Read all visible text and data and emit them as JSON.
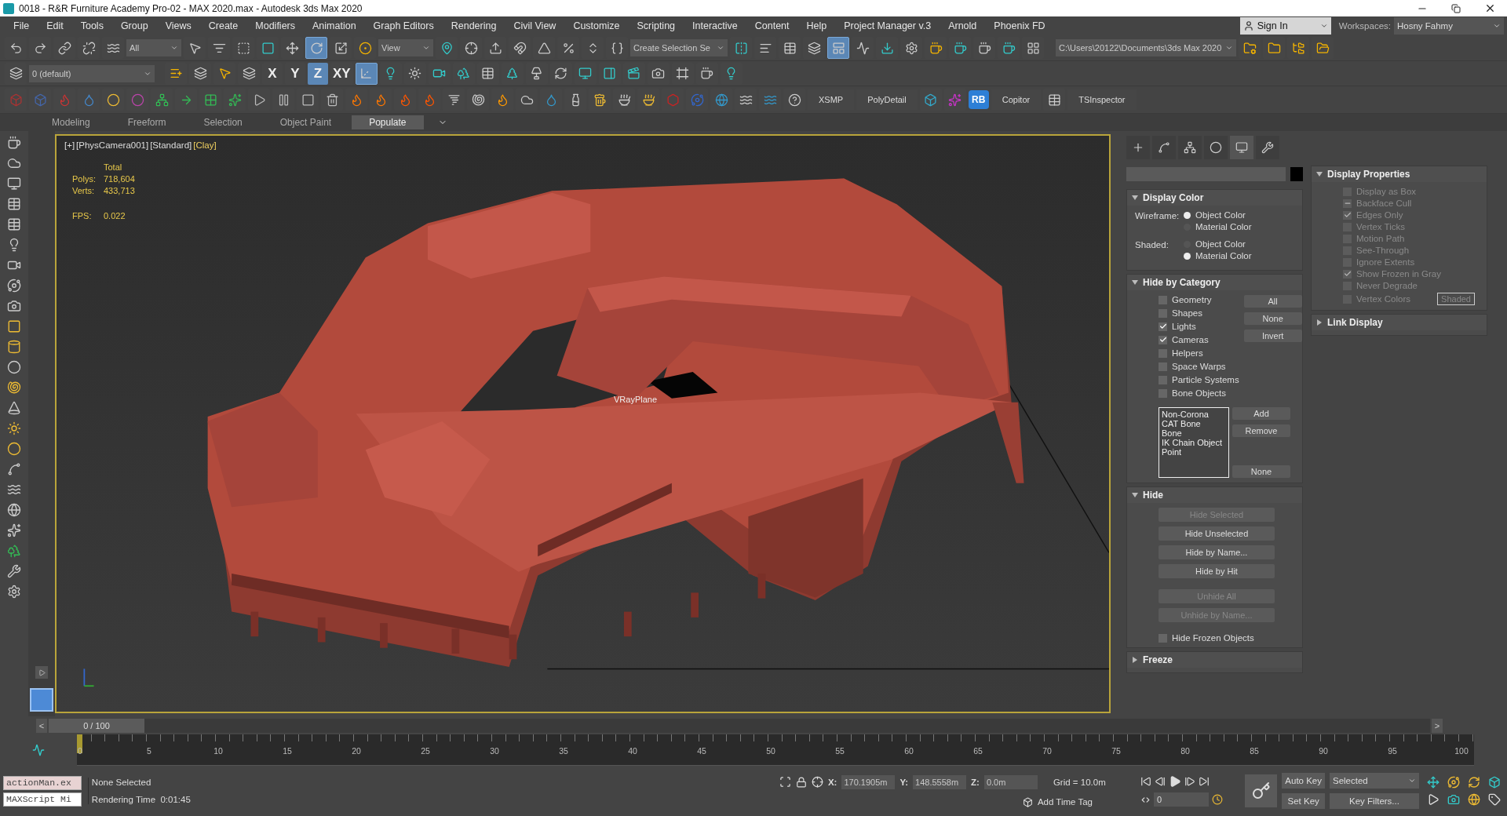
{
  "window": {
    "title": "0018 - R&R Furniture Academy Pro-02 - MAX 2020.max - Autodesk 3ds Max 2020"
  },
  "menu": [
    "File",
    "Edit",
    "Tools",
    "Group",
    "Views",
    "Create",
    "Modifiers",
    "Animation",
    "Graph Editors",
    "Rendering",
    "Civil View",
    "Customize",
    "Scripting",
    "Interactive",
    "Content",
    "Help",
    "Project Manager v.3",
    "Arnold",
    "Phoenix FD"
  ],
  "account": {
    "sign_in": "Sign In",
    "workspaces_label": "Workspaces:",
    "workspace": "Hosny Fahmy"
  },
  "toolbar_main": [
    {
      "kind": "button",
      "selected": false
    },
    {
      "kind": "button",
      "selected": false
    },
    {
      "kind": "button",
      "selected": false
    },
    {
      "kind": "button",
      "selected": false
    },
    {
      "kind": "button",
      "selected": false
    },
    {
      "kind": "dropdown",
      "value": "All"
    },
    {
      "kind": "button",
      "selected": false
    },
    {
      "kind": "button",
      "selected": false
    },
    {
      "kind": "button",
      "selected": false
    },
    {
      "kind": "button",
      "selected": false
    },
    {
      "kind": "button",
      "selected": false
    },
    {
      "kind": "button",
      "selected": true
    },
    {
      "kind": "button",
      "selected": false
    },
    {
      "kind": "button",
      "selected": false
    },
    {
      "kind": "dropdown",
      "value": "View"
    },
    {
      "kind": "button",
      "selected": false
    },
    {
      "kind": "button",
      "selected": false
    },
    {
      "kind": "button",
      "selected": false
    },
    {
      "kind": "button",
      "selected": false
    },
    {
      "kind": "button",
      "selected": false
    },
    {
      "kind": "button",
      "selected": false
    },
    {
      "kind": "button",
      "selected": false
    },
    {
      "kind": "button",
      "selected": false
    },
    {
      "kind": "dropdown",
      "value": "Create Selection Se"
    },
    {
      "kind": "button",
      "selected": false
    },
    {
      "kind": "button",
      "selected": false
    },
    {
      "kind": "button",
      "selected": false
    },
    {
      "kind": "button",
      "selected": false
    },
    {
      "kind": "button",
      "selected": true
    },
    {
      "kind": "button",
      "selected": false
    },
    {
      "kind": "button",
      "selected": false
    },
    {
      "kind": "button",
      "selected": false
    },
    {
      "kind": "button",
      "selected": false
    },
    {
      "kind": "button",
      "selected": false
    },
    {
      "kind": "button",
      "selected": false
    },
    {
      "kind": "button",
      "selected": false
    },
    {
      "kind": "button",
      "selected": false
    },
    {
      "kind": "path",
      "value": "C:\\Users\\20122\\Documents\\3ds Max 2020"
    },
    {
      "kind": "button",
      "selected": false
    },
    {
      "kind": "button",
      "selected": false
    },
    {
      "kind": "button",
      "selected": false
    },
    {
      "kind": "button",
      "selected": false
    }
  ],
  "toolbar_second": [
    {
      "kind": "button",
      "selected": false
    },
    {
      "kind": "layer",
      "value": "0 (default)"
    },
    {
      "kind": "button",
      "selected": false
    },
    {
      "kind": "button",
      "selected": false
    },
    {
      "kind": "button",
      "selected": false
    },
    {
      "kind": "button",
      "selected": false
    },
    {
      "kind": "axis",
      "label": "X",
      "selected": false
    },
    {
      "kind": "axis",
      "label": "Y",
      "selected": false
    },
    {
      "kind": "axis",
      "label": "Z",
      "selected": true
    },
    {
      "kind": "axis",
      "label": "XY",
      "selected": false
    },
    {
      "kind": "button",
      "selected": true
    },
    {
      "kind": "button",
      "selected": false
    },
    {
      "kind": "button",
      "selected": false
    },
    {
      "kind": "button",
      "selected": false
    },
    {
      "kind": "button",
      "selected": false
    },
    {
      "kind": "button",
      "selected": false
    },
    {
      "kind": "button",
      "selected": false
    },
    {
      "kind": "button",
      "selected": false
    },
    {
      "kind": "button",
      "selected": false
    },
    {
      "kind": "button",
      "selected": false
    },
    {
      "kind": "button",
      "selected": false
    },
    {
      "kind": "button",
      "selected": false
    },
    {
      "kind": "button",
      "selected": false
    },
    {
      "kind": "button",
      "selected": false
    },
    {
      "kind": "button",
      "selected": false
    },
    {
      "kind": "button",
      "selected": false
    }
  ],
  "toolbar_plugins": [
    {
      "kind": "button"
    },
    {
      "kind": "button"
    },
    {
      "kind": "button"
    },
    {
      "kind": "button"
    },
    {
      "kind": "button"
    },
    {
      "kind": "button"
    },
    {
      "kind": "button"
    },
    {
      "kind": "button"
    },
    {
      "kind": "button"
    },
    {
      "kind": "button"
    },
    {
      "kind": "button"
    },
    {
      "kind": "button"
    },
    {
      "kind": "button"
    },
    {
      "kind": "button"
    },
    {
      "kind": "button"
    },
    {
      "kind": "button"
    },
    {
      "kind": "button"
    },
    {
      "kind": "button"
    },
    {
      "kind": "button"
    },
    {
      "kind": "button"
    },
    {
      "kind": "button"
    },
    {
      "kind": "button"
    },
    {
      "kind": "button"
    },
    {
      "kind": "button"
    },
    {
      "kind": "button"
    },
    {
      "kind": "button"
    },
    {
      "kind": "button"
    },
    {
      "kind": "button"
    },
    {
      "kind": "button"
    },
    {
      "kind": "button"
    },
    {
      "kind": "button"
    },
    {
      "kind": "button"
    },
    {
      "kind": "button"
    },
    {
      "kind": "label",
      "text": "XSMP"
    },
    {
      "kind": "label",
      "text": "PolyDetail"
    },
    {
      "kind": "button"
    },
    {
      "kind": "button"
    },
    {
      "kind": "badge",
      "text": "RB"
    },
    {
      "kind": "label",
      "text": "Copitor"
    },
    {
      "kind": "button"
    },
    {
      "kind": "label",
      "text": "TSInspector"
    }
  ],
  "ribbon_tabs": [
    {
      "label": "Modeling",
      "selected": false
    },
    {
      "label": "Freeform",
      "selected": false
    },
    {
      "label": "Selection",
      "selected": false
    },
    {
      "label": "Object Paint",
      "selected": false
    },
    {
      "label": "Populate",
      "selected": true
    }
  ],
  "viewport": {
    "labels": [
      {
        "text": "[+]",
        "highlighted": false
      },
      {
        "text": "[PhysCamera001]",
        "highlighted": false
      },
      {
        "text": "[Standard]",
        "highlighted": false
      },
      {
        "text": "[Clay]",
        "highlighted": true
      }
    ],
    "stats_title": "Total",
    "stats": [
      {
        "label": "Polys:",
        "value": "718,604"
      },
      {
        "label": "Verts:",
        "value": "433,713"
      }
    ],
    "fps": {
      "label": "FPS:",
      "value": "0.022"
    },
    "object_label": "VRayPlane"
  },
  "command_panel": {
    "tabs": [
      {
        "selected": false
      },
      {
        "selected": false
      },
      {
        "selected": false
      },
      {
        "selected": false
      },
      {
        "selected": true
      },
      {
        "selected": false
      }
    ],
    "display_color": {
      "title": "Display Color",
      "expanded": true,
      "groups": [
        {
          "label": "Wireframe:",
          "options": [
            {
              "label": "Object Color",
              "selected": true
            },
            {
              "label": "Material Color",
              "selected": false
            }
          ]
        },
        {
          "label": "Shaded:",
          "options": [
            {
              "label": "Object Color",
              "selected": false
            },
            {
              "label": "Material Color",
              "selected": true
            }
          ]
        }
      ]
    },
    "hide_by_category": {
      "title": "Hide by Category",
      "expanded": true,
      "categories": [
        {
          "label": "Geometry",
          "checked": false
        },
        {
          "label": "Shapes",
          "checked": false
        },
        {
          "label": "Lights",
          "checked": true
        },
        {
          "label": "Cameras",
          "checked": true
        },
        {
          "label": "Helpers",
          "checked": false
        },
        {
          "label": "Space Warps",
          "checked": false
        },
        {
          "label": "Particle Systems",
          "checked": false
        },
        {
          "label": "Bone Objects",
          "checked": false
        }
      ],
      "buttons": [
        "All",
        "None",
        "Invert"
      ],
      "list": [
        "Non-Corona",
        "CAT Bone",
        "Bone",
        "IK Chain Object",
        "Point"
      ],
      "list_buttons": [
        "Add",
        "Remove",
        "None"
      ]
    },
    "hide": {
      "title": "Hide",
      "expanded": true,
      "groups": [
        [
          {
            "label": "Hide Selected",
            "disabled": true
          },
          {
            "label": "Hide Unselected",
            "disabled": false
          },
          {
            "label": "Hide by Name...",
            "disabled": false
          },
          {
            "label": "Hide by Hit",
            "disabled": false
          }
        ],
        [
          {
            "label": "Unhide All",
            "disabled": true
          },
          {
            "label": "Unhide by Name...",
            "disabled": true
          }
        ]
      ],
      "frozen": {
        "label": "Hide Frozen Objects",
        "checked": false
      }
    },
    "freeze": {
      "title": "Freeze",
      "expanded": false
    },
    "display_properties": {
      "title": "Display Properties",
      "expanded": true,
      "items": [
        {
          "label": "Display as Box",
          "checked": false,
          "mixed": false,
          "disabled": true
        },
        {
          "label": "Backface Cull",
          "checked": false,
          "mixed": true,
          "disabled": true
        },
        {
          "label": "Edges Only",
          "checked": true,
          "mixed": false,
          "disabled": true
        },
        {
          "label": "Vertex Ticks",
          "checked": false,
          "mixed": false,
          "disabled": true
        },
        {
          "label": "Motion Path",
          "checked": false,
          "mixed": false,
          "disabled": true
        },
        {
          "label": "See-Through",
          "checked": false,
          "mixed": false,
          "disabled": true
        },
        {
          "label": "Ignore Extents",
          "checked": false,
          "mixed": false,
          "disabled": true
        },
        {
          "label": "Show Frozen in Gray",
          "checked": true,
          "mixed": false,
          "disabled": true
        },
        {
          "label": "Never Degrade",
          "checked": false,
          "mixed": false,
          "disabled": true
        },
        {
          "label": "Vertex Colors",
          "checked": false,
          "mixed": false,
          "disabled": true
        }
      ],
      "shaded_button": "Shaded"
    },
    "link_display": {
      "title": "Link Display",
      "expanded": false
    }
  },
  "time_slider": {
    "prev": "<",
    "label": "0 / 100",
    "next": ">",
    "level": 0
  },
  "track_bar": {
    "ticks": [
      "0",
      "5",
      "10",
      "15",
      "20",
      "25",
      "30",
      "35",
      "40",
      "45",
      "50",
      "55",
      "60",
      "65",
      "70",
      "75",
      "80",
      "85",
      "90",
      "95",
      "100"
    ]
  },
  "status": {
    "listener": [
      "actionMan.ex",
      "MAXScript Mi"
    ],
    "prompt": "None Selected",
    "render_time_label": "Rendering Time",
    "render_time": "0:01:45",
    "coords": [
      {
        "axis": "X:",
        "value": "170.1905m"
      },
      {
        "axis": "Y:",
        "value": "148.5558m"
      },
      {
        "axis": "Z:",
        "value": "0.0m"
      }
    ],
    "grid": "Grid = 10.0m",
    "time_tag": "Add Time Tag",
    "frame": "0",
    "auto_key": {
      "label": "Auto Key",
      "on": false
    },
    "set_key": "Set Key",
    "key_mode": "Selected",
    "key_filters": "Key Filters..."
  }
}
